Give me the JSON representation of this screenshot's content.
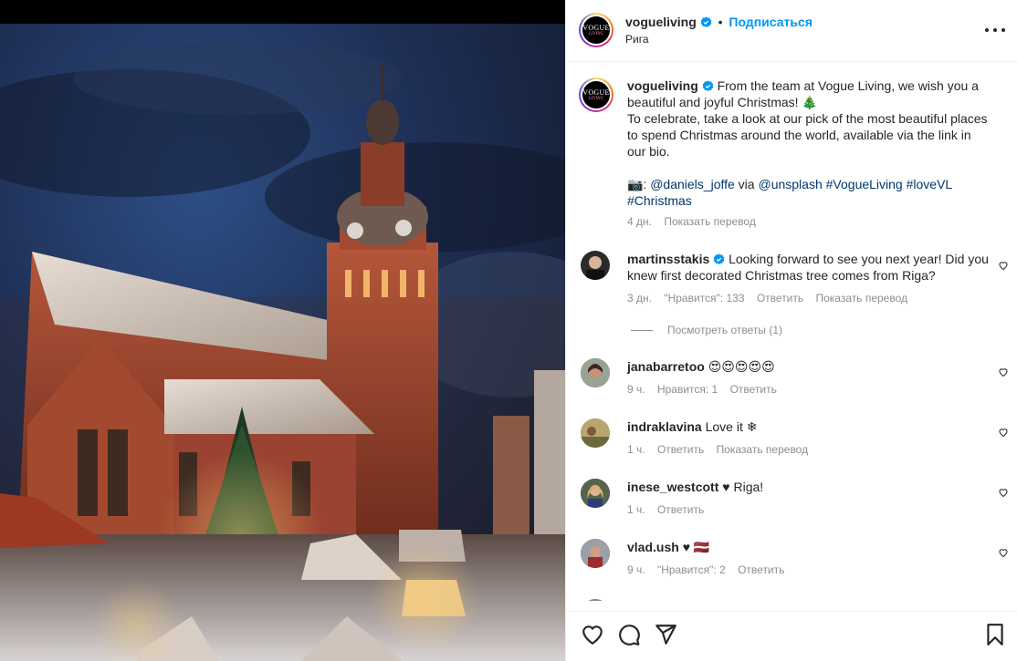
{
  "post": {
    "username": "vogueliving",
    "follow_label": "Подписаться",
    "location": "Рига",
    "logo_text": "VOGUE",
    "logo_sub": "LIVING"
  },
  "caption": {
    "username": "vogueliving",
    "line1": "From the team at Vogue Living, we wish you a beautiful and joyful Christmas! 🎄",
    "line2": "To celebrate, take a look at our pick of the most beautiful places to spend Christmas around the world, available via the link in our bio.",
    "credit_prefix": "📷: ",
    "mention1": "@daniels_joffe",
    "via": " via ",
    "mention2": "@unsplash",
    "tag1": "#VogueLiving",
    "tag2": "#loveVL",
    "tag3": "#Christmas",
    "time": "4 дн.",
    "translate": "Показать перевод"
  },
  "comments": [
    {
      "username": "martinsstakis",
      "verified": true,
      "text": "Looking forward to see you next year! Did you knew first decorated Christmas tree comes from Riga?",
      "time": "3 дн.",
      "likes": "\"Нравится\": 133",
      "reply": "Ответить",
      "translate": "Показать перевод",
      "replies": "Посмотреть ответы (1)"
    },
    {
      "username": "janabarretoo",
      "text": "😍😍😍😍😍",
      "time": "9 ч.",
      "likes": "Нравится: 1",
      "reply": "Ответить"
    },
    {
      "username": "indraklavina",
      "text": "Love it ❄",
      "time": "1 ч.",
      "reply": "Ответить",
      "translate": "Показать перевод"
    },
    {
      "username": "inese_westcott",
      "text": "♥ Riga!",
      "time": "1 ч.",
      "reply": "Ответить"
    },
    {
      "username": "vlad.ush",
      "text": "♥ 🇱🇻",
      "time": "9 ч.",
      "likes": "\"Нравится\": 2",
      "reply": "Ответить"
    }
  ],
  "icons": {
    "like": "heart-icon",
    "comment": "comment-icon",
    "share": "share-icon",
    "save": "bookmark-icon",
    "more": "more-icon",
    "verified": "verified-badge-icon"
  },
  "colors": {
    "accent": "#0095f6",
    "link": "#00376b",
    "muted": "#8e8e8e",
    "text": "#262626"
  }
}
